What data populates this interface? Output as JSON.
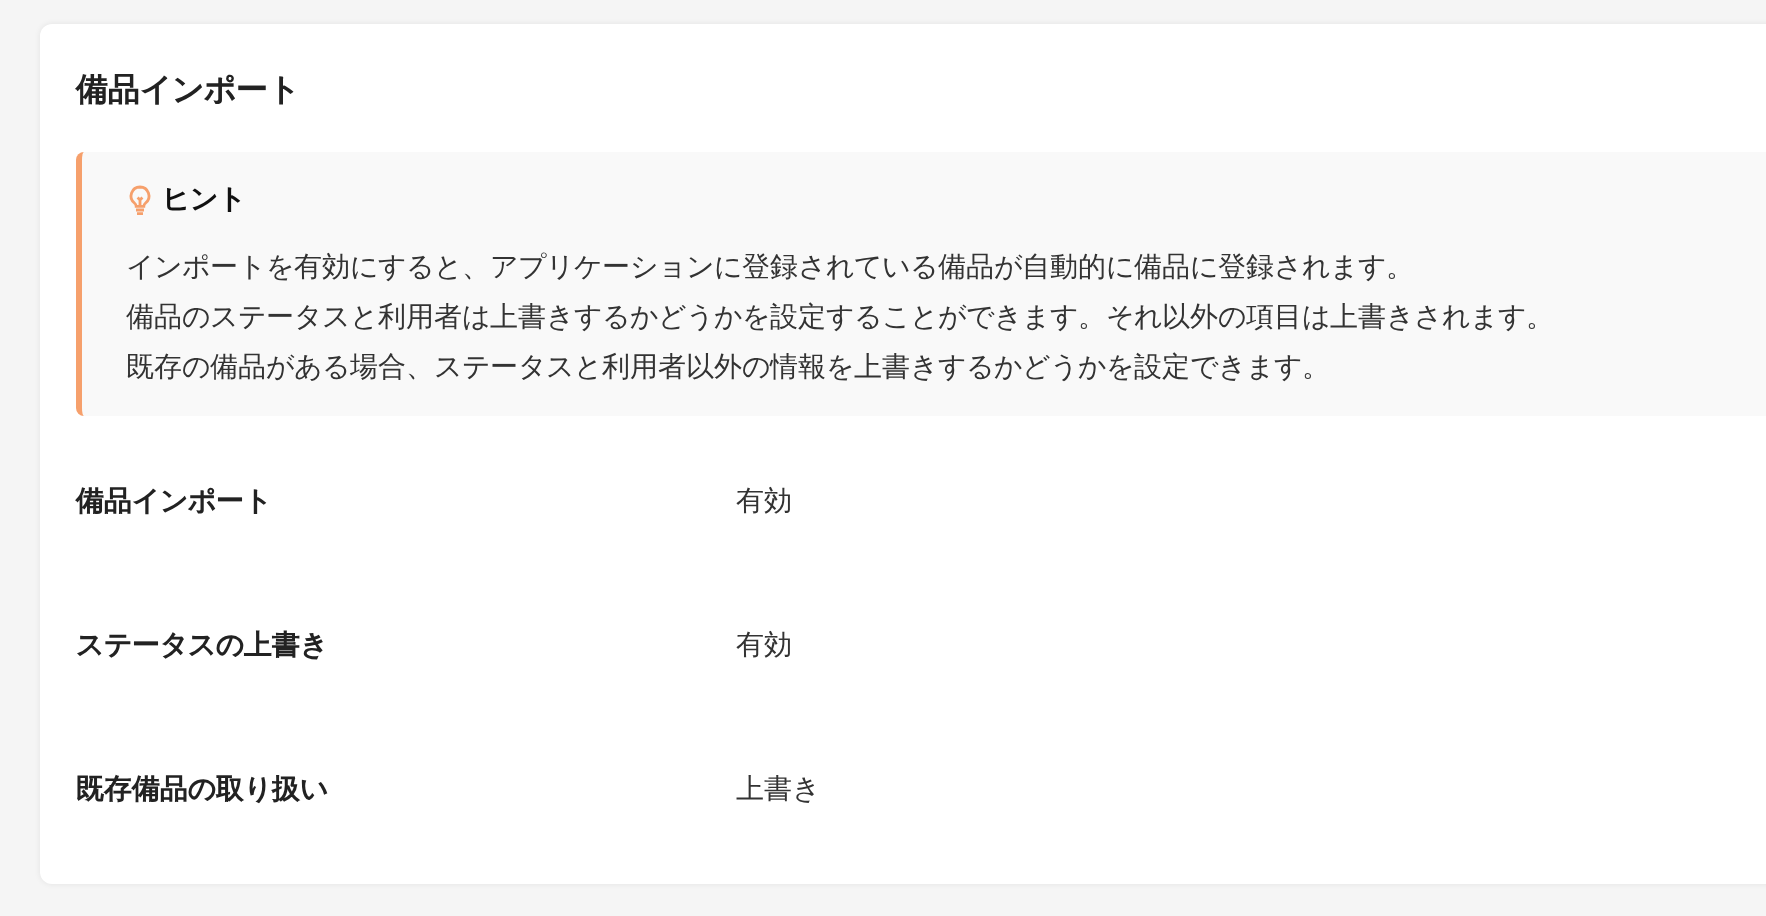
{
  "card": {
    "title": "備品インポート",
    "hint": {
      "title": "ヒント",
      "lines": [
        "インポートを有効にすると、アプリケーションに登録されている備品が自動的に備品に登録されます。",
        "備品のステータスと利用者は上書きするかどうかを設定することができます。それ以外の項目は上書きされます。",
        "既存の備品がある場合、ステータスと利用者以外の情報を上書きするかどうかを設定できます。"
      ]
    },
    "settings": [
      {
        "label": "備品インポート",
        "value": "有効"
      },
      {
        "label": "ステータスの上書き",
        "value": "有効"
      },
      {
        "label": "既存備品の取り扱い",
        "value": "上書き"
      }
    ]
  }
}
